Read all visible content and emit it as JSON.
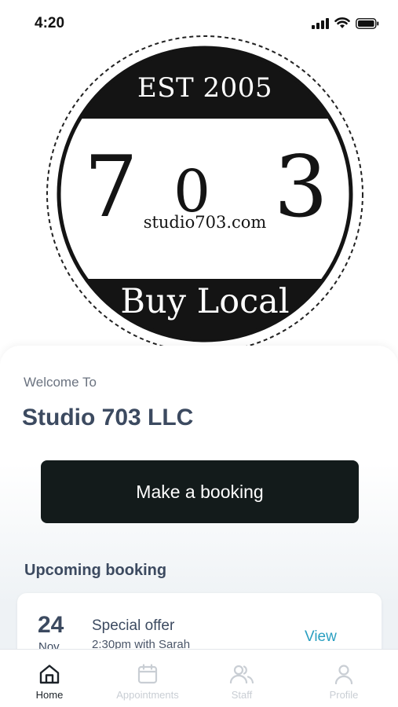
{
  "status_bar": {
    "time": "4:20",
    "icons": [
      "signal-icon",
      "wifi-icon",
      "battery-icon"
    ]
  },
  "logo": {
    "top_text": "EST 2005",
    "digits": [
      "7",
      "0",
      "3"
    ],
    "url": "studio703.com",
    "bottom_text": "Buy Local"
  },
  "welcome": {
    "label": "Welcome To",
    "business_name": "Studio 703 LLC"
  },
  "booking_button": {
    "label": "Make a booking"
  },
  "upcoming": {
    "title": "Upcoming booking",
    "card": {
      "day": "24",
      "month": "Nov",
      "title": "Special offer",
      "subtitle": "2:30pm with Sarah",
      "action": "View"
    }
  },
  "tab_bar": {
    "items": [
      {
        "label": "Home",
        "icon": "home-icon",
        "active": true
      },
      {
        "label": "Appointments",
        "icon": "calendar-icon",
        "active": false
      },
      {
        "label": "Staff",
        "icon": "users-icon",
        "active": false
      },
      {
        "label": "Profile",
        "icon": "person-icon",
        "active": false
      }
    ]
  },
  "colors": {
    "primary_button": "#131b1b",
    "heading_text": "#3c4a60",
    "link": "#2a9fc1",
    "inactive_tab": "#c9ced4"
  }
}
